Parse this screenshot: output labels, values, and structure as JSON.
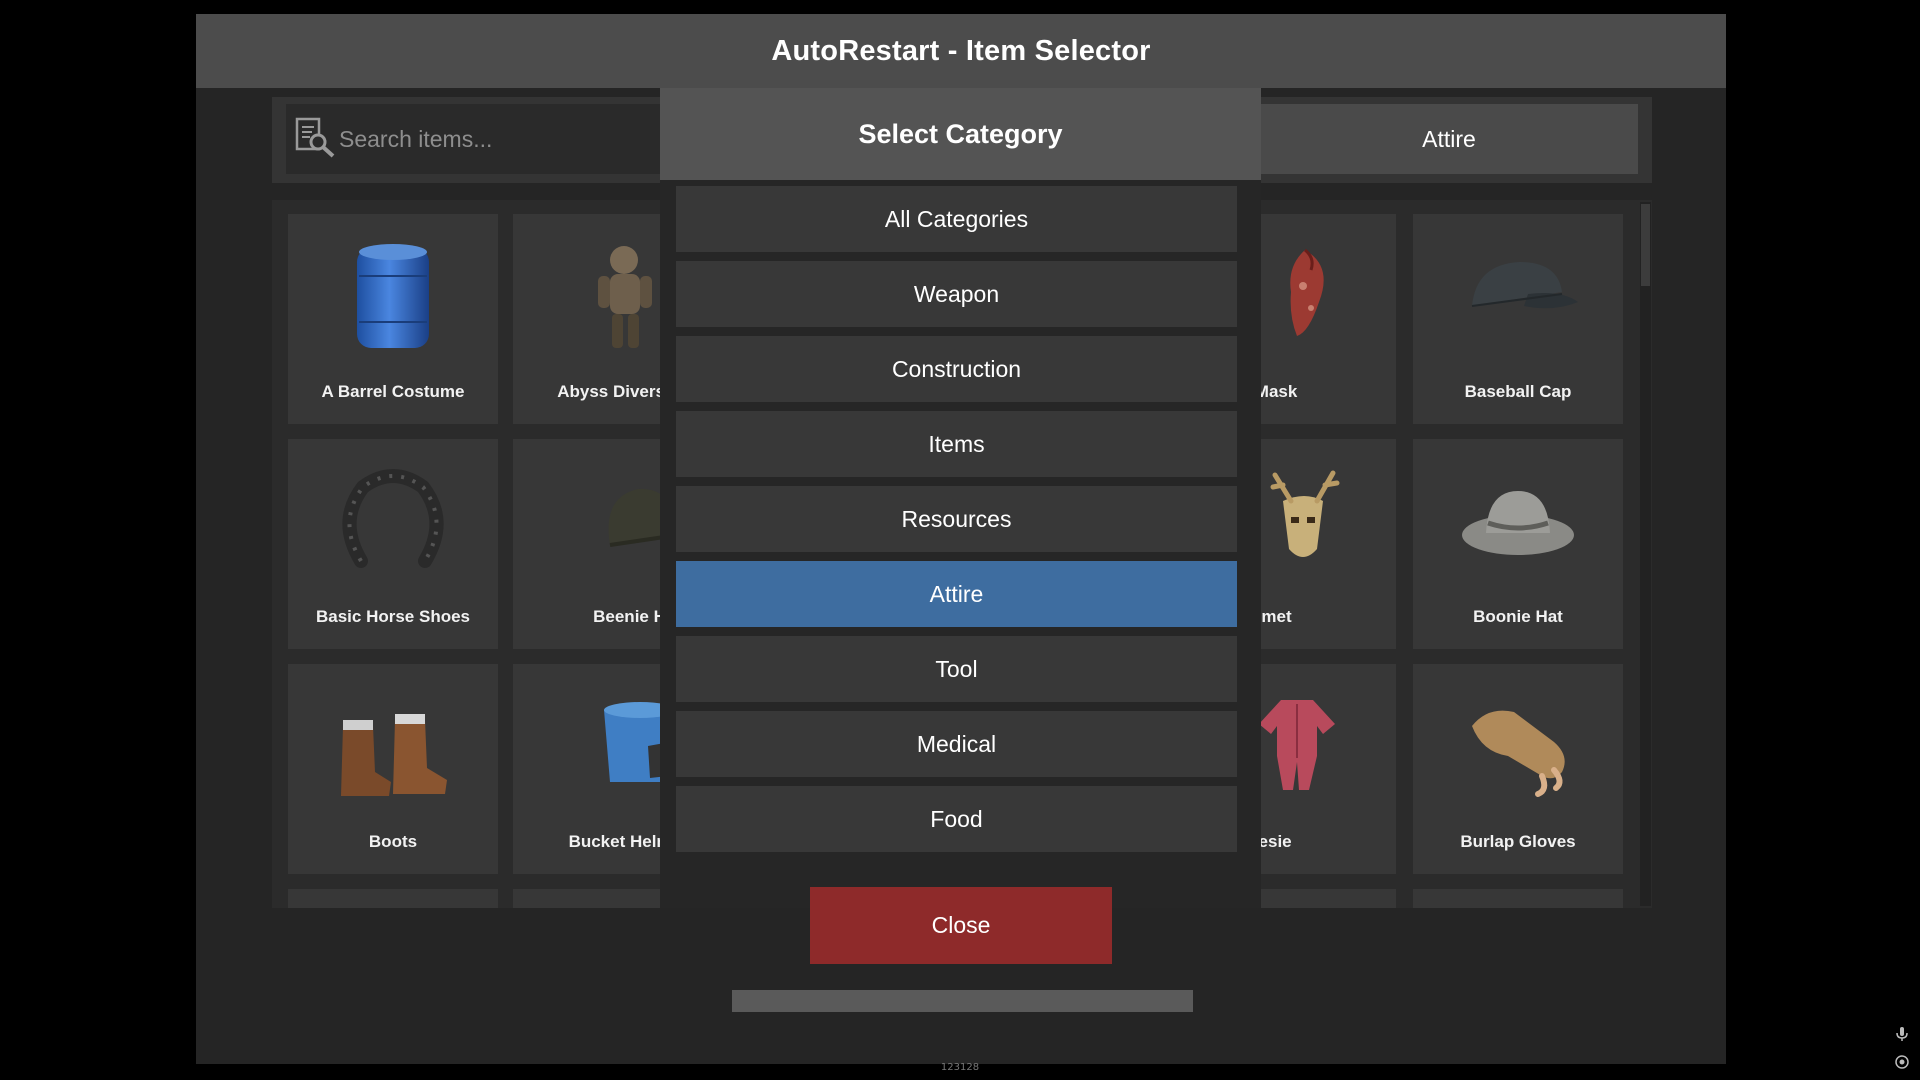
{
  "window": {
    "title": "AutoRestart - Item Selector"
  },
  "search": {
    "placeholder": "Search items...",
    "value": ""
  },
  "category_button": {
    "label": "Attire"
  },
  "items": {
    "row1": [
      {
        "label": "A Barrel Costume",
        "icon": "barrel-costume"
      },
      {
        "label": "Abyss Divers S",
        "icon": "diver-suit"
      },
      {
        "label": "ndana Mask",
        "icon": "bandana-mask"
      },
      {
        "label": "Baseball Cap",
        "icon": "baseball-cap"
      }
    ],
    "row2": [
      {
        "label": "Basic Horse Shoes",
        "icon": "horse-shoe"
      },
      {
        "label": "Beenie Hat",
        "icon": "beenie-hat"
      },
      {
        "label": "one Helmet",
        "icon": "bone-helmet"
      },
      {
        "label": "Boonie Hat",
        "icon": "boonie-hat"
      }
    ],
    "row3": [
      {
        "label": "Boots",
        "icon": "boots"
      },
      {
        "label": "Bucket Helme",
        "icon": "bucket-helmet"
      },
      {
        "label": "nny Onesie",
        "icon": "onesie"
      },
      {
        "label": "Burlap Gloves",
        "icon": "gloves"
      }
    ]
  },
  "modal": {
    "title": "Select Category",
    "categories": [
      "All Categories",
      "Weapon",
      "Construction",
      "Items",
      "Resources",
      "Attire",
      "Tool",
      "Medical",
      "Food"
    ],
    "selected": "Attire",
    "close_label": "Close"
  },
  "footer": {
    "text": "123128"
  },
  "colors": {
    "selected": "#3e6da0",
    "close": "#8e2a2a",
    "header": "#4c4c4c"
  }
}
